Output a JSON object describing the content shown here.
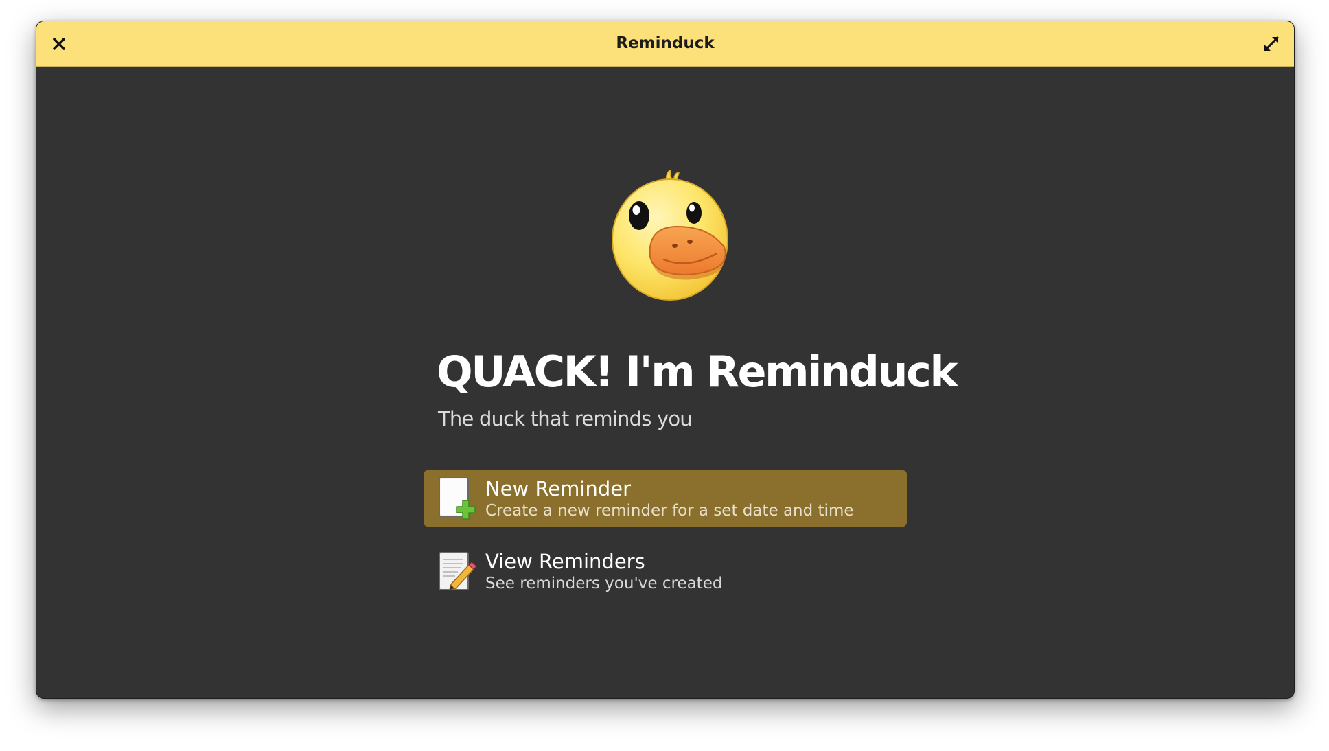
{
  "window": {
    "title": "Reminduck",
    "close_icon": "close-icon",
    "maximize_icon": "maximize-icon",
    "titlebar_color": "#fce07a",
    "background_color": "#333333"
  },
  "welcome": {
    "logo_icon": "duck-icon",
    "title": "QUACK! I'm Reminduck",
    "subtitle": "The duck that reminds you"
  },
  "actions": [
    {
      "icon": "new-document-icon",
      "title": "New Reminder",
      "description": "Create a new reminder for a set date and time",
      "selected": true,
      "accent_color": "#8b6f2c"
    },
    {
      "icon": "edit-document-icon",
      "title": "View Reminders",
      "description": "See reminders you've created",
      "selected": false
    }
  ]
}
